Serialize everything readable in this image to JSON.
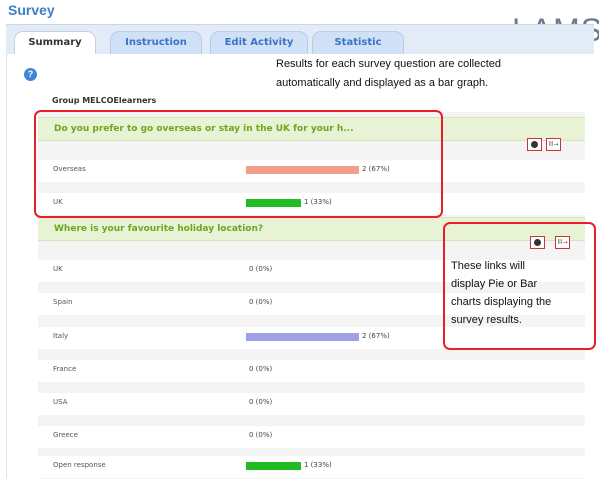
{
  "app": {
    "title": "Survey",
    "logo": "LAMS"
  },
  "tabs": [
    {
      "label": "Summary",
      "active": true
    },
    {
      "label": "Instruction",
      "active": false
    },
    {
      "label": "Edit Activity",
      "active": false
    },
    {
      "label": "Statistic",
      "active": false
    }
  ],
  "annotations": {
    "top_line1": "Results for each survey question are collected",
    "top_line2": "automatically and displayed as a bar graph.",
    "right_lines": [
      "These links will",
      "display Pie or Bar",
      "charts displaying the",
      "survey results."
    ]
  },
  "group": {
    "label": "Group MELCOElearners"
  },
  "questions": [
    {
      "text": "Do you prefer to go overseas or stay in the UK for your h...",
      "pie_icon": "pie-chart-icon",
      "bar_icon": "bar-chart-icon",
      "bar_label": "lll→",
      "answers": [
        {
          "label": "Overseas",
          "count_text": "2 (67%)",
          "fraction": 0.67,
          "color": "#f0a08a"
        },
        {
          "label": "UK",
          "count_text": "1 (33%)",
          "fraction": 0.33,
          "color": "#22bb22"
        }
      ]
    },
    {
      "text": "Where is your favourite holiday location?",
      "pie_icon": "pie-chart-icon",
      "bar_icon": "bar-chart-icon",
      "bar_label": "lll→",
      "answers": [
        {
          "label": "UK",
          "count_text": "0 (0%)",
          "fraction": 0,
          "color": "#22bb22"
        },
        {
          "label": "Spain",
          "count_text": "0 (0%)",
          "fraction": 0,
          "color": "#22bb22"
        },
        {
          "label": "Italy",
          "count_text": "2 (67%)",
          "fraction": 0.67,
          "color": "#9ea0e8"
        },
        {
          "label": "France",
          "count_text": "0 (0%)",
          "fraction": 0,
          "color": "#22bb22"
        },
        {
          "label": "USA",
          "count_text": "0 (0%)",
          "fraction": 0,
          "color": "#22bb22"
        },
        {
          "label": "Greece",
          "count_text": "0 (0%)",
          "fraction": 0,
          "color": "#22bb22"
        },
        {
          "label": "Open response",
          "count_text": "1 (33%)",
          "fraction": 0.33,
          "color": "#22bb22"
        }
      ]
    }
  ],
  "colors": {
    "accent": "#3e7fc7",
    "question_text": "#6aa821",
    "callout": "#e81e2c"
  }
}
